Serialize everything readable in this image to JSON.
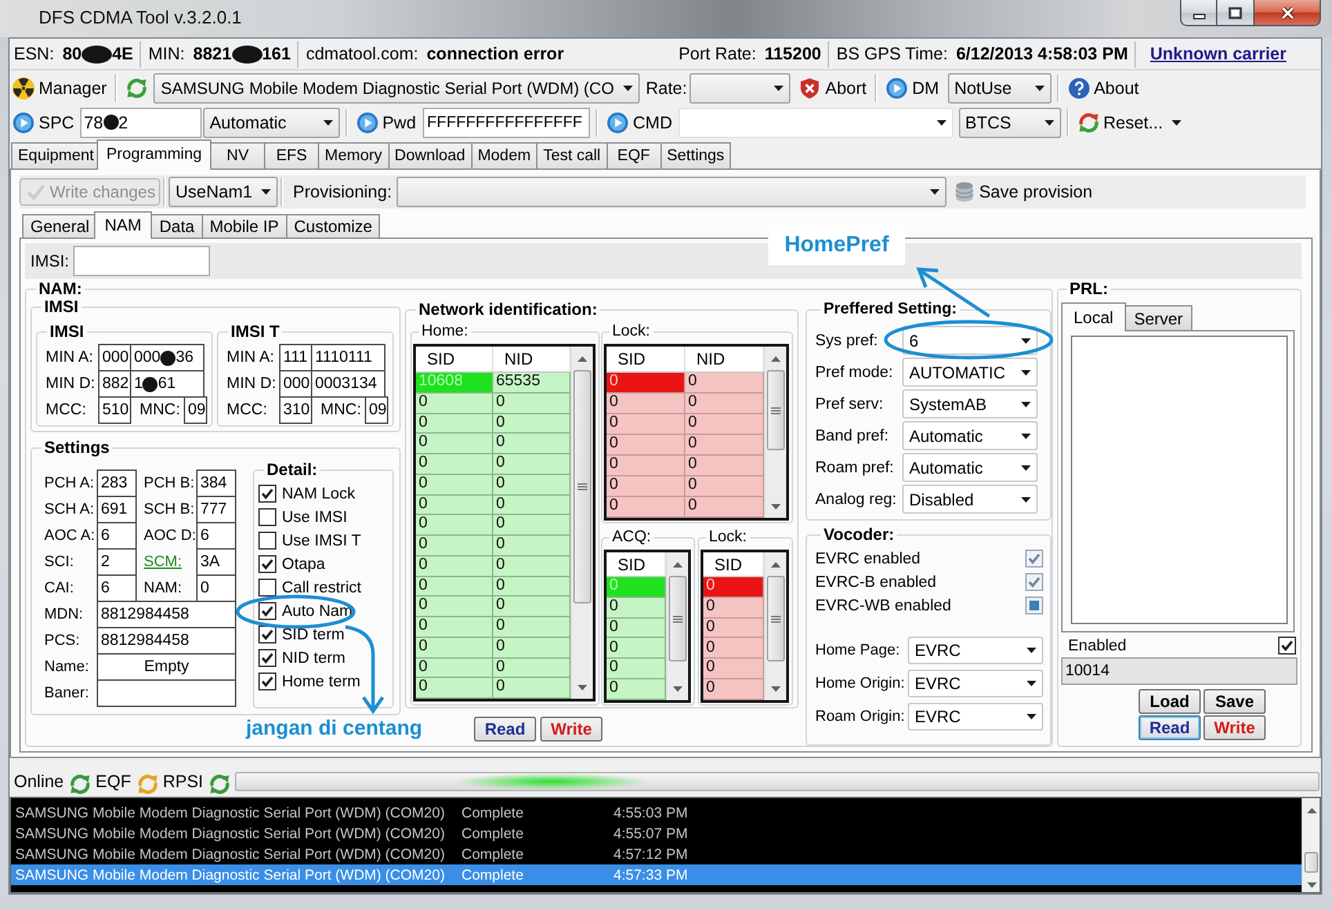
{
  "window": {
    "title": "DFS CDMA Tool v.3.2.0.1"
  },
  "info_bar": {
    "left": [
      {
        "label": "ESN:",
        "value": [
          "80",
          "4E"
        ]
      },
      {
        "label": "MIN:",
        "value": [
          "8821",
          "161"
        ]
      },
      {
        "label": "cdmatool.com:",
        "value": "connection error"
      }
    ],
    "right": [
      {
        "label": "Port Rate:",
        "value": "115200"
      },
      {
        "label": "BS GPS Time:",
        "value": "6/12/2013 4:58:03 PM"
      }
    ],
    "carrier_link": "Unknown carrier"
  },
  "toolbar": {
    "manager": "Manager",
    "port": "SAMSUNG Mobile Modem Diagnostic Serial Port (WDM) (CO",
    "rate_label": "Rate:",
    "abort": "Abort",
    "dm": "DM",
    "dm_mode": "NotUse",
    "about": "About"
  },
  "login_bar": {
    "spc_label": "SPC",
    "spc": [
      "78",
      "2"
    ],
    "spc_mode": "Automatic",
    "pwd_label": "Pwd",
    "pwd": "FFFFFFFFFFFFFFFF",
    "cmd_label": "CMD",
    "protocol": "BTCS",
    "reset": "Reset..."
  },
  "tabs": [
    {
      "label": "Equipment",
      "selected": false
    },
    {
      "label": "Programming",
      "selected": true
    },
    {
      "label": "NV",
      "selected": false
    },
    {
      "label": "EFS",
      "selected": false
    },
    {
      "label": "Memory",
      "selected": false
    },
    {
      "label": "Download",
      "selected": false
    },
    {
      "label": "Modem",
      "selected": false
    },
    {
      "label": "Test call",
      "selected": false
    },
    {
      "label": "EQF",
      "selected": false
    },
    {
      "label": "Settings",
      "selected": false
    }
  ],
  "provision_bar": {
    "write_changes": {
      "label": "Write changes",
      "disabled": true
    },
    "nam_slot": "UseNam1",
    "provisioning_label": "Provisioning:",
    "save_provision": "Save provision"
  },
  "subtabs": [
    {
      "label": "General",
      "selected": false
    },
    {
      "label": "NAM",
      "selected": true
    },
    {
      "label": "Data",
      "selected": false
    },
    {
      "label": "Mobile IP",
      "selected": false
    },
    {
      "label": "Customize",
      "selected": false
    }
  ],
  "imsi_field": {
    "label": "IMSI:"
  },
  "nam": {
    "title": "NAM:",
    "imsi": {
      "title": "IMSI",
      "groups": [
        {
          "title": "IMSI",
          "rows": [
            {
              "label": "MIN A:",
              "values": [
                "000",
                [
                  "000",
                  "36"
                ]
              ]
            },
            {
              "label": "MIN D:",
              "values": [
                "882",
                [
                  "1",
                  "61"
                ]
              ]
            }
          ],
          "mcc": {
            "label": "MCC:",
            "value": "510"
          },
          "mnc": {
            "label": "MNC:",
            "value": "09"
          }
        },
        {
          "title": "IMSI T",
          "rows": [
            {
              "label": "MIN A:",
              "values": [
                "111",
                "1110111"
              ]
            },
            {
              "label": "MIN D:",
              "values": [
                "000",
                "0003134"
              ]
            }
          ],
          "mcc": {
            "label": "MCC:",
            "value": "310"
          },
          "mnc": {
            "label": "MNC:",
            "value": "09"
          }
        }
      ]
    },
    "settings": {
      "title": "Settings",
      "pairs": [
        [
          {
            "label": "PCH A:",
            "value": "283",
            "kind": "plain"
          },
          {
            "label": "PCH B:",
            "value": "384",
            "kind": "plain"
          }
        ],
        [
          {
            "label": "SCH A:",
            "value": "691",
            "kind": "plain"
          },
          {
            "label": "SCH B:",
            "value": "777",
            "kind": "plain"
          }
        ],
        [
          {
            "label": "AOC A:",
            "value": "6",
            "kind": "plain"
          },
          {
            "label": "AOC D:",
            "value": "6",
            "kind": "plain"
          }
        ],
        [
          {
            "label": "SCI:",
            "value": "2",
            "kind": "plain"
          },
          {
            "label": "SCM:",
            "value": "3A",
            "kind": "link"
          }
        ],
        [
          {
            "label": "CAI:",
            "value": "6",
            "kind": "plain"
          },
          {
            "label": "NAM:",
            "value": "0",
            "kind": "plain"
          }
        ]
      ],
      "fields": [
        {
          "label": "MDN:",
          "value": "8812984458"
        },
        {
          "label": "PCS:",
          "value": "8812984458"
        },
        {
          "label": "Name:",
          "value": "Empty"
        },
        {
          "label": "Baner:"
        }
      ],
      "detail": {
        "title": "Detail:",
        "options": [
          {
            "label": "NAM Lock",
            "checked": true
          },
          {
            "label": "Use IMSI",
            "checked": false
          },
          {
            "label": "Use IMSI T",
            "checked": false
          },
          {
            "label": "Otapa",
            "checked": true
          },
          {
            "label": "Call restrict",
            "checked": false
          },
          {
            "label": "Auto Nam",
            "checked": true
          },
          {
            "label": "SID term",
            "checked": true
          },
          {
            "label": "NID term",
            "checked": true
          },
          {
            "label": "Home term",
            "checked": true
          }
        ]
      }
    },
    "network": {
      "title": "Network identification:",
      "tables": [
        {
          "title": "Home:",
          "kind": "home",
          "columns": [
            "SID",
            "NID"
          ],
          "rows": [
            {
              "cells": [
                "10608",
                "65535"
              ],
              "selected": true
            },
            {
              "cells": [
                "0",
                "0"
              ],
              "selected": false
            },
            {
              "cells": [
                "0",
                "0"
              ],
              "selected": false
            },
            {
              "cells": [
                "0",
                "0"
              ],
              "selected": false
            },
            {
              "cells": [
                "0",
                "0"
              ],
              "selected": false
            },
            {
              "cells": [
                "0",
                "0"
              ],
              "selected": false
            },
            {
              "cells": [
                "0",
                "0"
              ],
              "selected": false
            },
            {
              "cells": [
                "0",
                "0"
              ],
              "selected": false
            },
            {
              "cells": [
                "0",
                "0"
              ],
              "selected": false
            },
            {
              "cells": [
                "0",
                "0"
              ],
              "selected": false
            },
            {
              "cells": [
                "0",
                "0"
              ],
              "selected": false
            },
            {
              "cells": [
                "0",
                "0"
              ],
              "selected": false
            },
            {
              "cells": [
                "0",
                "0"
              ],
              "selected": false
            },
            {
              "cells": [
                "0",
                "0"
              ],
              "selected": false
            },
            {
              "cells": [
                "0",
                "0"
              ],
              "selected": false
            },
            {
              "cells": [
                "0",
                "0"
              ],
              "selected": false
            }
          ]
        },
        {
          "title": "Lock:",
          "kind": "lock",
          "columns": [
            "SID",
            "NID"
          ],
          "rows": [
            {
              "cells": [
                "0",
                "0"
              ],
              "selected": true
            },
            {
              "cells": [
                "0",
                "0"
              ],
              "selected": false
            },
            {
              "cells": [
                "0",
                "0"
              ],
              "selected": false
            },
            {
              "cells": [
                "0",
                "0"
              ],
              "selected": false
            },
            {
              "cells": [
                "0",
                "0"
              ],
              "selected": false
            },
            {
              "cells": [
                "0",
                "0"
              ],
              "selected": false
            },
            {
              "cells": [
                "0",
                "0"
              ],
              "selected": false
            }
          ]
        },
        {
          "title": "ACQ:",
          "kind": "home",
          "columns": [
            "SID"
          ],
          "rows": [
            {
              "cells": [
                "0"
              ],
              "selected": true
            },
            {
              "cells": [
                "0"
              ],
              "selected": false
            },
            {
              "cells": [
                "0"
              ],
              "selected": false
            },
            {
              "cells": [
                "0"
              ],
              "selected": false
            },
            {
              "cells": [
                "0"
              ],
              "selected": false
            },
            {
              "cells": [
                "0"
              ],
              "selected": false
            }
          ]
        },
        {
          "title": "Lock:",
          "kind": "lock",
          "columns": [
            "SID"
          ],
          "rows": [
            {
              "cells": [
                "0"
              ],
              "selected": true
            },
            {
              "cells": [
                "0"
              ],
              "selected": false
            },
            {
              "cells": [
                "0"
              ],
              "selected": false
            },
            {
              "cells": [
                "0"
              ],
              "selected": false
            },
            {
              "cells": [
                "0"
              ],
              "selected": false
            },
            {
              "cells": [
                "0"
              ],
              "selected": false
            }
          ]
        }
      ],
      "buttons": [
        {
          "label": "Read",
          "kind": "read"
        },
        {
          "label": "Write",
          "kind": "write"
        }
      ]
    },
    "preferred": {
      "title": "Preffered Setting:",
      "fields": [
        {
          "label": "Sys pref:",
          "value": "6"
        },
        {
          "label": "Pref mode:",
          "value": "AUTOMATIC"
        },
        {
          "label": "Pref serv:",
          "value": "SystemAB"
        },
        {
          "label": "Band pref:",
          "value": "Automatic"
        },
        {
          "label": "Roam pref:",
          "value": "Automatic"
        },
        {
          "label": "Analog reg:",
          "value": "Disabled"
        }
      ]
    },
    "vocoder": {
      "title": "Vocoder:",
      "options": [
        {
          "label": "EVRC enabled",
          "checked": true,
          "indeterminate": false,
          "disabled": true
        },
        {
          "label": "EVRC-B enabled",
          "checked": true,
          "indeterminate": false,
          "disabled": true
        },
        {
          "label": "EVRC-WB enabled",
          "checked": false,
          "indeterminate": true,
          "disabled": true
        }
      ],
      "fields": [
        {
          "label": "Home Page:",
          "value": "EVRC"
        },
        {
          "label": "Home Origin:",
          "value": "EVRC"
        },
        {
          "label": "Roam Origin:",
          "value": "EVRC"
        }
      ]
    }
  },
  "prl": {
    "title": "PRL:",
    "tabs": [
      {
        "label": "Local",
        "selected": true
      },
      {
        "label": "Server",
        "selected": false
      }
    ],
    "enabled": {
      "label": "Enabled",
      "checked": true
    },
    "version": "10014",
    "buttons": [
      {
        "label": "Load",
        "kind": "load",
        "focused": false
      },
      {
        "label": "Save",
        "kind": "save",
        "focused": false
      },
      {
        "label": "Read",
        "kind": "read",
        "focused": true
      },
      {
        "label": "Write",
        "kind": "write",
        "focused": false
      }
    ]
  },
  "status_bar": {
    "items": [
      {
        "label": "Online",
        "color": "#3a9a3a"
      },
      {
        "label": "EQF",
        "color": "#e0a81c"
      },
      {
        "label": "RPSI",
        "color": "#3a9a3a"
      }
    ],
    "progress": {
      "indeterminate": true
    }
  },
  "log": [
    {
      "device": "SAMSUNG Mobile Modem Diagnostic Serial Port (WDM) (COM20)",
      "status": "Complete",
      "time": "4:55:03 PM",
      "selected": false
    },
    {
      "device": "SAMSUNG Mobile Modem Diagnostic Serial Port (WDM) (COM20)",
      "status": "Complete",
      "time": "4:55:07 PM",
      "selected": false
    },
    {
      "device": "SAMSUNG Mobile Modem Diagnostic Serial Port (WDM) (COM20)",
      "status": "Complete",
      "time": "4:57:12 PM",
      "selected": false
    },
    {
      "device": "SAMSUNG Mobile Modem Diagnostic Serial Port (WDM) (COM20)",
      "status": "Complete",
      "time": "4:57:33 PM",
      "selected": true
    }
  ],
  "annotations": [
    {
      "text": "HomePref"
    },
    {
      "text": "jangan di centang"
    }
  ]
}
